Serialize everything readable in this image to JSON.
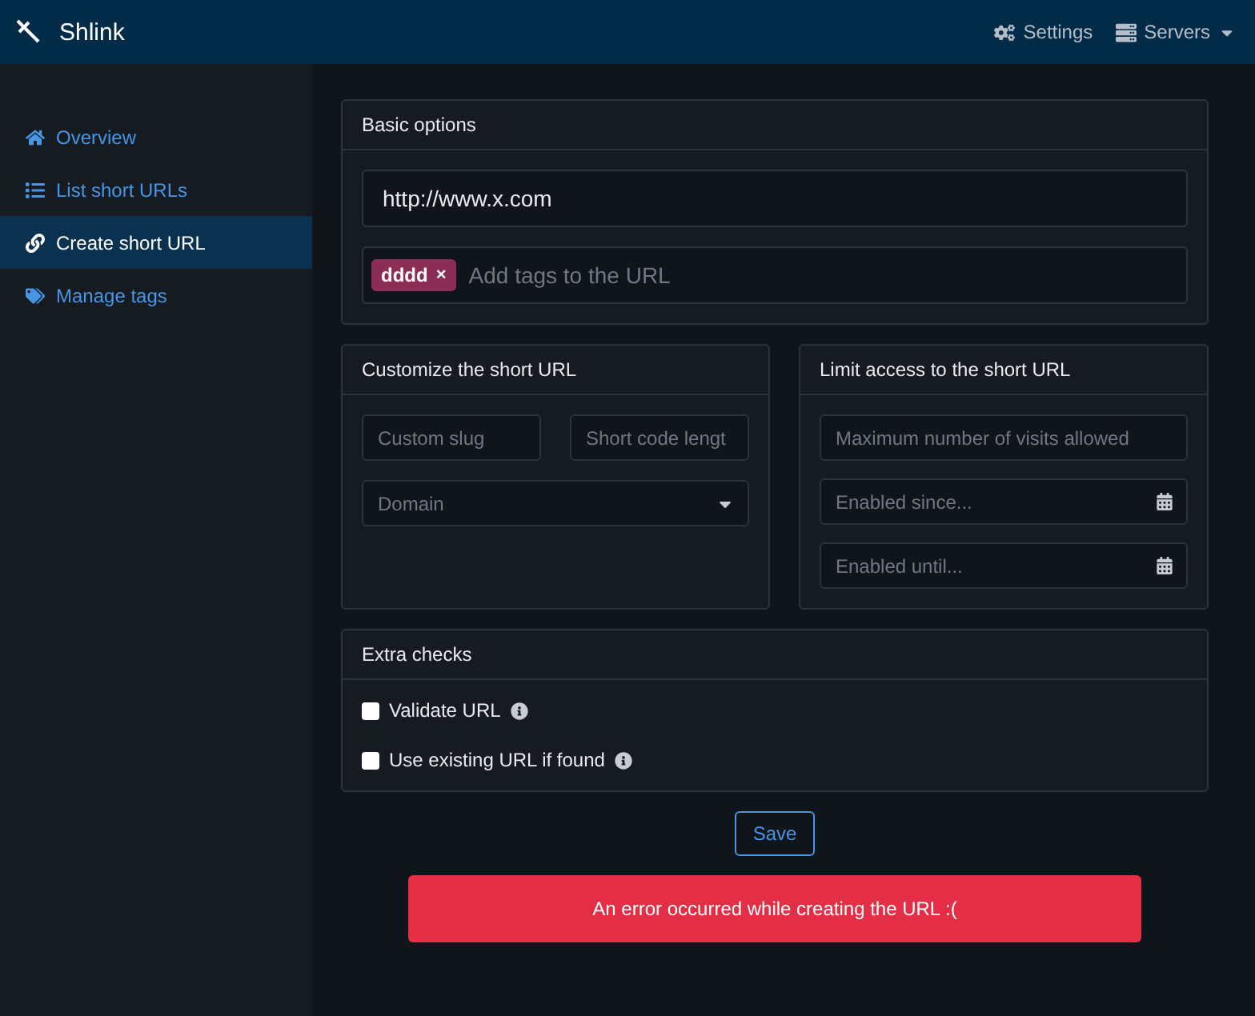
{
  "header": {
    "brand": "Shlink",
    "links": [
      {
        "kind": "settings",
        "label": "Settings"
      },
      {
        "kind": "servers",
        "label": "Servers"
      }
    ]
  },
  "sidebar": {
    "items": [
      {
        "kind": "home",
        "label": "Overview",
        "selected": false
      },
      {
        "kind": "list",
        "label": "List short URLs",
        "selected": false
      },
      {
        "kind": "link",
        "label": "Create short URL",
        "selected": true
      },
      {
        "kind": "tags",
        "label": "Manage tags",
        "selected": false
      }
    ]
  },
  "basic_options": {
    "title": "Basic options",
    "url": "http://www.x.com",
    "tags": [
      "dddd"
    ],
    "tag_remove": "×",
    "tags_placeholder": "Add tags to the URL"
  },
  "customize": {
    "title": "Customize the short URL",
    "slug_placeholder": "Custom slug",
    "length_placeholder": "Short code lengt",
    "domain_placeholder": "Domain"
  },
  "limit_access": {
    "title": "Limit access to the short URL",
    "max_visits_placeholder": "Maximum number of visits allowed",
    "since_placeholder": "Enabled since...",
    "until_placeholder": "Enabled until..."
  },
  "extra_checks": {
    "title": "Extra checks",
    "options": [
      {
        "label": "Validate URL",
        "checked": false
      },
      {
        "label": "Use existing URL if found",
        "checked": false
      }
    ]
  },
  "save_button": "Save",
  "error": "An error occurred while creating the URL :("
}
